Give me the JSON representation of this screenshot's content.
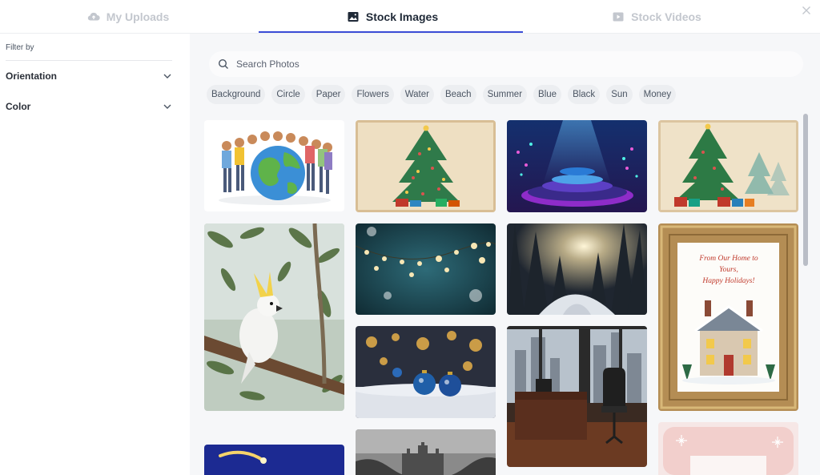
{
  "tabs": [
    {
      "label": "My Uploads",
      "active": false,
      "icon": "cloud-upload-icon"
    },
    {
      "label": "Stock Images",
      "active": true,
      "icon": "image-icon"
    },
    {
      "label": "Stock Videos",
      "active": false,
      "icon": "video-icon"
    }
  ],
  "sidebar": {
    "filter_by": "Filter by",
    "filters": [
      {
        "label": "Orientation",
        "icon": "chevron-down-icon"
      },
      {
        "label": "Color",
        "icon": "chevron-down-icon"
      }
    ]
  },
  "search": {
    "placeholder": "Search Photos",
    "value": ""
  },
  "chips": [
    "Background",
    "Circle",
    "Paper",
    "Flowers",
    "Water",
    "Beach",
    "Summer",
    "Blue",
    "Black",
    "Sun",
    "Money"
  ],
  "gallery": [
    {
      "subject": "kids-with-globe",
      "bg": "#ffffff"
    },
    {
      "subject": "christmas-tree-on-parchment",
      "bg": "#efe0c4"
    },
    {
      "subject": "neon-podium",
      "bg": "#1a1f5c"
    },
    {
      "subject": "christmas-tree-with-gifts",
      "bg": "#efe2c8"
    },
    {
      "subject": "cockatoo-on-branch",
      "bg": "#a9b7a0"
    },
    {
      "subject": "star-string-lights",
      "bg": "#1d4a55"
    },
    {
      "subject": "snowy-forest-sunbeam",
      "bg": "#2b3440"
    },
    {
      "subject": "holiday-card-house",
      "bg": "#b48d54"
    },
    {
      "subject": "christmas-ornaments-bokeh",
      "bg": "#2a2f3d"
    },
    {
      "subject": "office-with-city-view",
      "bg": "#e6e6e8"
    },
    {
      "subject": "shooting-star-night",
      "bg": "#1d2a8a"
    },
    {
      "subject": "castle-monochrome",
      "bg": "#6b6b6b"
    },
    {
      "subject": "pink-frame",
      "bg": "#f2d2cf"
    }
  ],
  "card_text": {
    "line1": "From Our Home to",
    "line2": "Yours,",
    "line3": "Happy Holidays!"
  },
  "colors": {
    "accent": "#3b4dd6",
    "tab_inactive": "#c3c7ce",
    "main_bg": "#f6f7f9",
    "chip_bg": "#eceef1"
  }
}
